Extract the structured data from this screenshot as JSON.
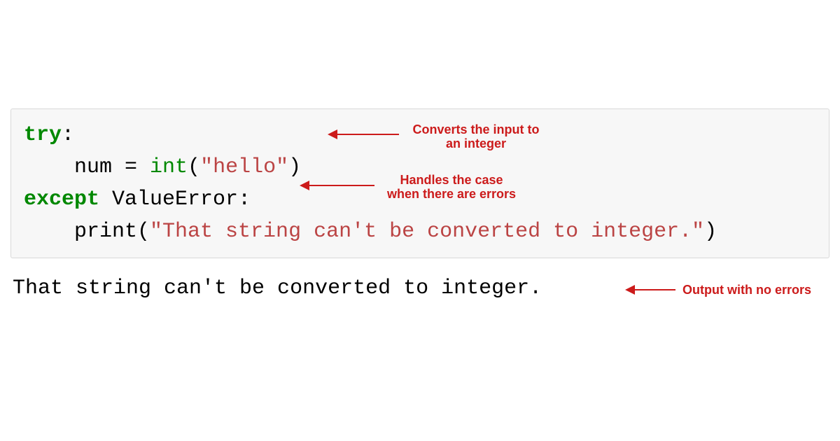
{
  "code": {
    "line1_kw": "try",
    "line1_colon": ":",
    "line2_indent": "    num = ",
    "line2_fn": "int",
    "line2_open": "(",
    "line2_str": "\"hello\"",
    "line2_close": ")",
    "line3_kw": "except",
    "line3_rest": " ValueError:",
    "line4_indent": "    print(",
    "line4_str": "\"That string can't be converted to integer.\"",
    "line4_close": ")"
  },
  "output": "That string can't be converted to integer.",
  "annotations": {
    "a1_l1": "Converts the input to",
    "a1_l2": "an integer",
    "a2_l1": "Handles the case",
    "a2_l2": "when there are errors",
    "a3": "Output with no errors"
  }
}
